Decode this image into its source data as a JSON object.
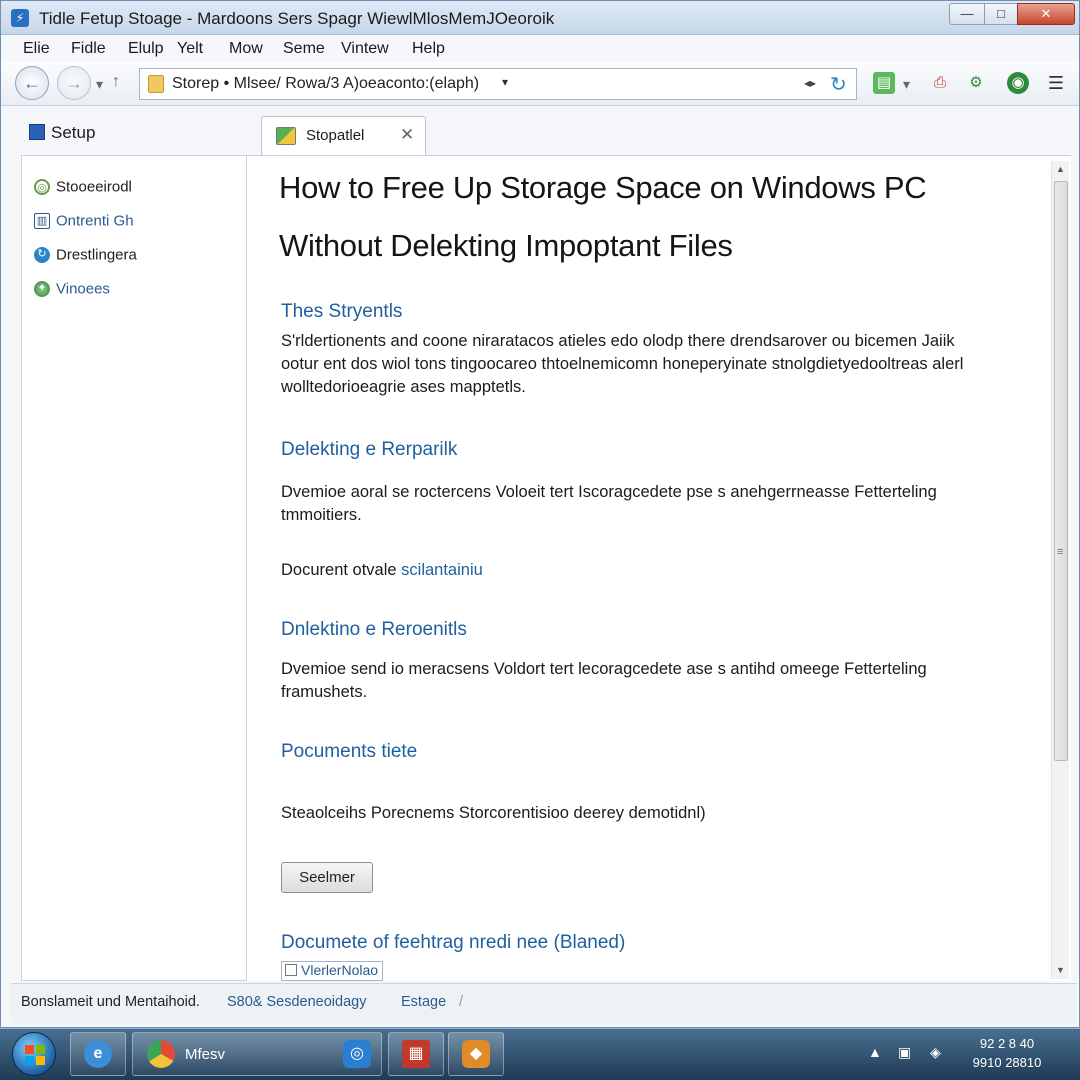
{
  "window": {
    "title": "Tidle Fetup Stoage - Mardoons Sers Spagr WiewlMlosMemJOeoroik",
    "min_glyph": "—",
    "max_glyph": "□",
    "close_glyph": "✕"
  },
  "menu": [
    "Elie",
    "Fidle",
    "Elulp",
    "Yelt",
    "Mow",
    "Seme",
    "Vintew",
    "Help"
  ],
  "toolbar": {
    "back_glyph": "←",
    "forward_glyph": "→",
    "history_glyph": "▾",
    "up_glyph": "↑",
    "address": "Storep • Mlsee/ Rowa/3 A)oeaconto:(elaph)",
    "address_dropdown_glyph": "▾",
    "compat_glyph": "◂▸",
    "refresh_glyph": "↻"
  },
  "sidebar": {
    "header": "Setup",
    "items": [
      {
        "label": "Stooeeirodl",
        "icon": "gear-icon",
        "color": "#4a7a3a"
      },
      {
        "label": "Ontrenti Gh",
        "icon": "chart-icon",
        "color": "#2a5b8e"
      },
      {
        "label": "Drestlingera",
        "icon": "refresh-icon",
        "color": "#2a84c5"
      },
      {
        "label": "Vinoees",
        "icon": "globe-icon",
        "color": "#2a5b8e"
      }
    ]
  },
  "tab": {
    "label": "Stopatlel",
    "close_glyph": "✕"
  },
  "content": {
    "title_line1": "How to Free Up Storage Space on Windows PC",
    "title_line2": "Without Delekting Impoptant Files",
    "sections": [
      {
        "heading": "Thes Stryentls",
        "lines": [
          "S'rldertionents and coone niraratacos atieles edo olodp there drendsarover ou bicemen Jaiik",
          "ootur ent dos wiol tons tingoocareo thtoelnemicomn honeperyinate stnolgdietyedooltreas alerl",
          "wolltedorioeagrie ases mapptetls."
        ]
      },
      {
        "heading": "Delekting e Rerparilk",
        "lines": [
          "Dvemioe aoral se roctercens Voloeit tert Iscoragcedete pse s anehgerrneasse Fetterteling",
          "tmmoitiers."
        ]
      },
      {
        "inline_prefix": "Docurent otvale ",
        "inline_link": "scilantainiu"
      },
      {
        "heading": "Dnlektino e Reroenitls",
        "lines": [
          "Dvemioe send io meracsens Voldort tert lecoragcedete ase s antihd omeege Fetterteling",
          "framushets."
        ]
      },
      {
        "heading": "Pocuments tiete"
      },
      {
        "text": "Steaolceihs Porecnems Storcorentisioo deerey demotidnl)"
      }
    ],
    "button_label": "Seelmer",
    "bottom_heading": "Documete of feehtrag nredi nee (Blaned)",
    "doc_item_label": "VlerlerNolao"
  },
  "statusbar": {
    "left": "Bonslameit und Mentaihoid.",
    "middle": "S80& Sesdeneoidagy",
    "right": "Estage"
  },
  "taskbar": {
    "browser_label": "Mfesv",
    "clock_time": "92 2 8 40",
    "clock_date": "9910 28810"
  },
  "colors": {
    "accent_blue": "#1f5f9e",
    "title_bar": "#c6d7ea",
    "taskbar": "#1f3a55"
  }
}
